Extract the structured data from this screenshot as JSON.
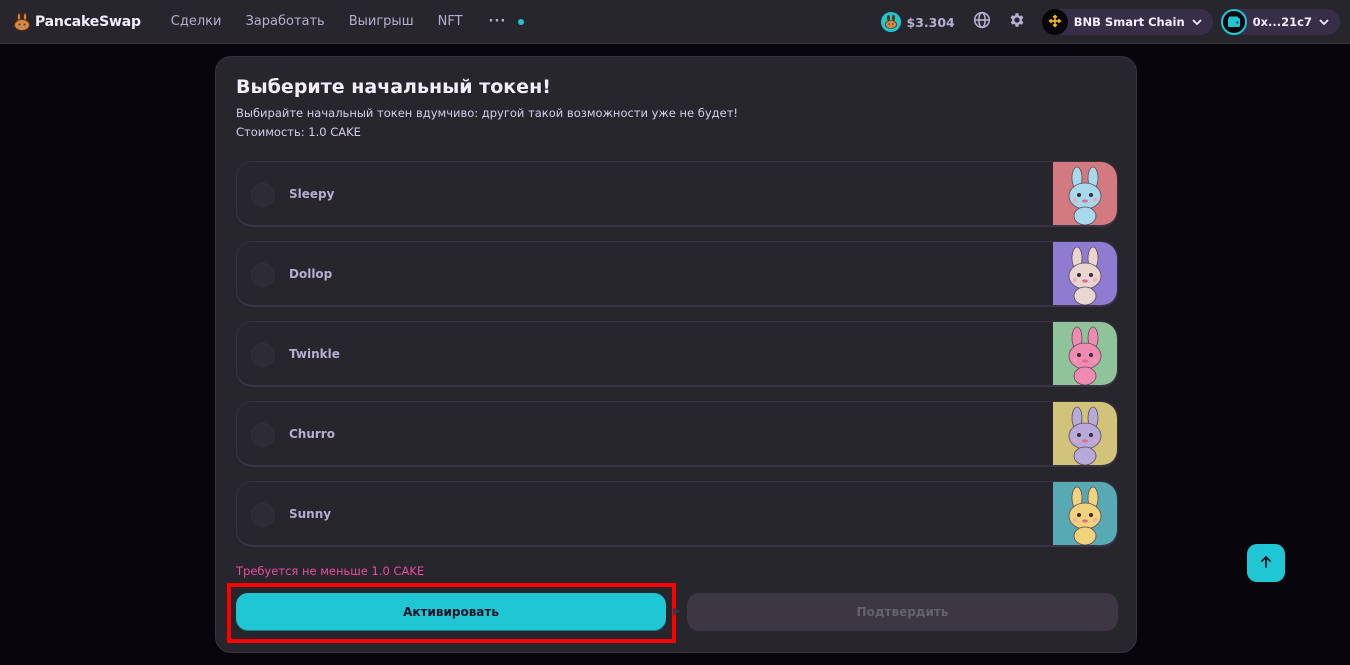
{
  "nav": {
    "brand": "PancakeSwap",
    "menu": [
      {
        "label": "Сделки"
      },
      {
        "label": "Заработать"
      },
      {
        "label": "Выигрыш"
      },
      {
        "label": "NFT"
      }
    ],
    "more_label": "···",
    "cake_price": "$3.304",
    "network_label": "BNB Smart Chain",
    "wallet_label": "0x...21c7"
  },
  "card": {
    "title": "Выберите начальный токен!",
    "subtitle": "Выбирайте начальный токен вдумчиво: другой такой возможности уже не будет!",
    "cost": "Стоимость: 1.0 CAKE",
    "options": [
      {
        "name": "Sleepy",
        "thumb_bg": "#d27a7f",
        "bunny_color": "#a8d8ec"
      },
      {
        "name": "Dollop",
        "thumb_bg": "#8f7bd1",
        "bunny_color": "#e8d6cf"
      },
      {
        "name": "Twinkle",
        "thumb_bg": "#8fc39a",
        "bunny_color": "#f08ab0"
      },
      {
        "name": "Churro",
        "thumb_bg": "#d1c47a",
        "bunny_color": "#b7a9d9"
      },
      {
        "name": "Sunny",
        "thumb_bg": "#57a9b4",
        "bunny_color": "#f2d27a"
      }
    ],
    "error": "Требуется не меньше 1.0 CAKE",
    "activate_label": "Активировать",
    "confirm_label": "Подтвердить"
  },
  "colors": {
    "accent": "#1fc7d4",
    "error": "#ed4b9e",
    "highlight": "#ff0000",
    "card_bg": "#27262c",
    "page_bg": "#08060b"
  },
  "icons": {
    "brand": "bunny-logo-icon",
    "cake": "cake-token-icon",
    "language": "globe-icon",
    "settings": "gear-icon",
    "network": "bnb-chain-icon",
    "wallet": "wallet-icon",
    "dropdown": "chevron-down-icon",
    "scroll_top": "arrow-up-icon"
  }
}
